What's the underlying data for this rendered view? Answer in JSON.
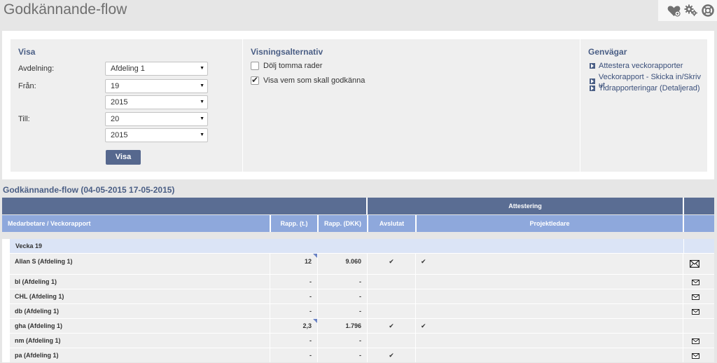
{
  "page": {
    "title": "Godkännande-flow"
  },
  "icons": {
    "favorite": "heart-icon",
    "settings": "gear-icon",
    "help": "lifebuoy-icon",
    "mail": "envelope-icon",
    "tick": "checkmark-icon",
    "link_arrow": "triangle-right-icon"
  },
  "colors": {
    "accent": "#56688e",
    "header_dark": "#5a6d93",
    "header_light": "#8ea8dc",
    "week_row": "#dbe4f6",
    "check": "#3aa83a"
  },
  "filters": {
    "visa": {
      "title": "Visa",
      "avdelning_label": "Avdelning:",
      "avdelning_value": "Afdeling 1",
      "fran_label": "Från:",
      "fran_week": "19",
      "fran_year": "2015",
      "till_label": "Till:",
      "till_week": "20",
      "till_year": "2015",
      "button_label": "Visa"
    },
    "options": {
      "title": "Visningsalternativ",
      "hide_empty_label": "Dölj tomma rader",
      "hide_empty_checked": false,
      "show_approver_label": "Visa vem som skall godkänna",
      "show_approver_checked": true
    },
    "shortcuts": {
      "title": "Genvägar",
      "links": [
        "Attestera veckorapporter",
        "Veckorapport - Skicka in/Skriv ut",
        "Tidrapporteringar (Detaljerad)"
      ]
    }
  },
  "table": {
    "title": "Godkännande-flow (04-05-2015 17-05-2015)",
    "group_header": "Attestering",
    "columns": {
      "name": "Medarbetare / Veckorapport",
      "rapp_t": "Rapp. (t.)",
      "rapp_dkk": "Rapp. (DKK)",
      "avslutat": "Avslutat",
      "projektledare": "Projektledare"
    },
    "week_label": "Vecka 19",
    "rows": [
      {
        "name": "Allan S (Afdeling 1)",
        "rapp_t": "12",
        "rapp_dkk": "9.060",
        "avslutat": "✔",
        "projektledare": "✔",
        "mail": true
      },
      {
        "name": "bl (Afdeling 1)",
        "rapp_t": "-",
        "rapp_dkk": "-",
        "avslutat": "",
        "projektledare": "",
        "mail": true
      },
      {
        "name": "CHL (Afdeling 1)",
        "rapp_t": "-",
        "rapp_dkk": "-",
        "avslutat": "",
        "projektledare": "",
        "mail": true
      },
      {
        "name": "db (Afdeling 1)",
        "rapp_t": "-",
        "rapp_dkk": "-",
        "avslutat": "",
        "projektledare": "",
        "mail": true
      },
      {
        "name": "gha (Afdeling 1)",
        "rapp_t": "2,3",
        "rapp_dkk": "1.796",
        "avslutat": "✔",
        "projektledare": "✔",
        "mail": false
      },
      {
        "name": "nm (Afdeling 1)",
        "rapp_t": "-",
        "rapp_dkk": "-",
        "avslutat": "",
        "projektledare": "",
        "mail": true
      },
      {
        "name": "pa (Afdeling 1)",
        "rapp_t": "-",
        "rapp_dkk": "-",
        "avslutat": "✔",
        "projektledare": "",
        "mail": true
      }
    ]
  }
}
